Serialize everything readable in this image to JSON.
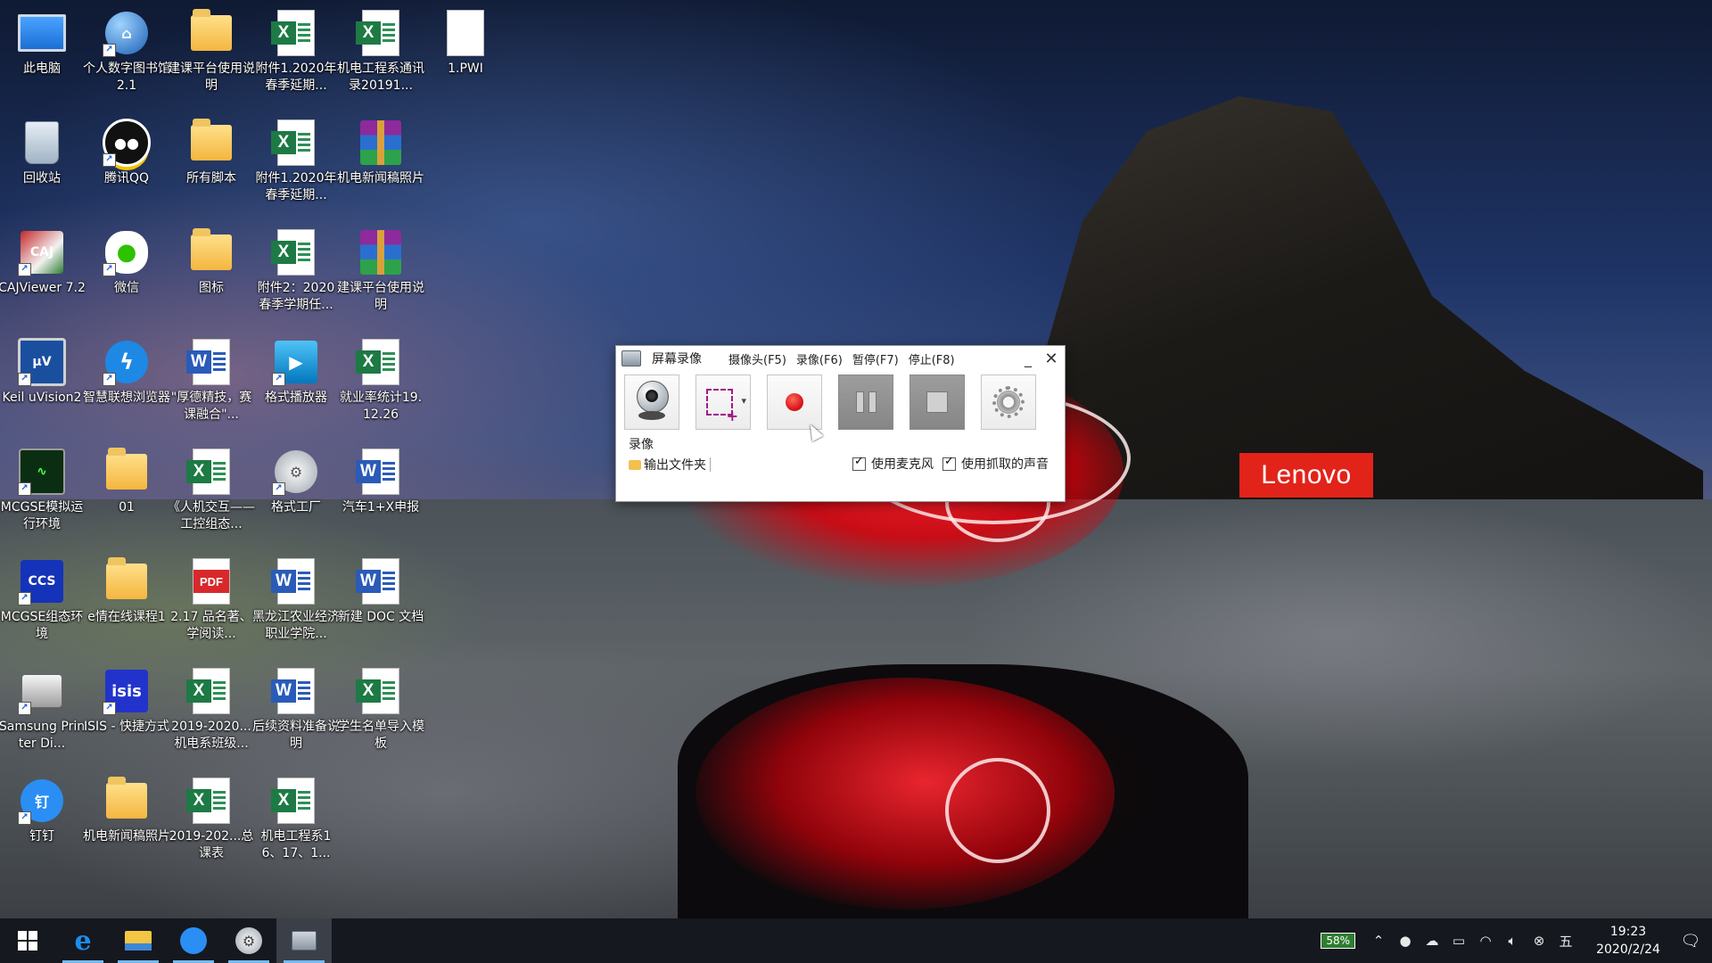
{
  "wallpaper": {
    "brand_text": "Lenovo",
    "brand_color": "#e2231a"
  },
  "desktop": {
    "icons": [
      {
        "label": "此电脑",
        "icon": "computer-icon"
      },
      {
        "label": "个人数字图书馆2.1",
        "icon": "globe-app-icon"
      },
      {
        "label": "建课平台使用说明",
        "icon": "folder-icon"
      },
      {
        "label": "附件1.2020年春季延期...",
        "icon": "excel-file-icon"
      },
      {
        "label": "机电工程系通讯录20191...",
        "icon": "excel-file-icon"
      },
      {
        "label": "1.PWI",
        "icon": "blank-file-icon"
      },
      {
        "label": "回收站",
        "icon": "recycle-bin-icon"
      },
      {
        "label": "腾讯QQ",
        "icon": "qq-icon"
      },
      {
        "label": "所有脚本",
        "icon": "folder-icon"
      },
      {
        "label": "附件1.2020年春季延期...",
        "icon": "excel-file-icon"
      },
      {
        "label": "机电新闻稿照片",
        "icon": "rar-archive-icon"
      },
      {
        "label": "CAJViewer 7.2",
        "icon": "cajviewer-icon"
      },
      {
        "label": "微信",
        "icon": "wechat-icon"
      },
      {
        "label": "图标",
        "icon": "folder-icon"
      },
      {
        "label": "附件2：2020春季学期任...",
        "icon": "excel-file-icon"
      },
      {
        "label": "建课平台使用说明",
        "icon": "rar-archive-icon"
      },
      {
        "label": "Keil uVision2",
        "icon": "keil-icon"
      },
      {
        "label": "智慧联想浏览器",
        "icon": "lenovo-browser-icon"
      },
      {
        "label": "\"厚德精技，赛课融合\"...",
        "icon": "word-file-icon"
      },
      {
        "label": "格式播放器",
        "icon": "video-player-icon"
      },
      {
        "label": "就业率统计19.12.26",
        "icon": "excel-file-icon"
      },
      {
        "label": "MCGSE模拟运行环境",
        "icon": "mcgs-sim-icon"
      },
      {
        "label": "01",
        "icon": "folder-icon"
      },
      {
        "label": "《人机交互——工控组态...",
        "icon": "excel-file-icon"
      },
      {
        "label": "格式工厂",
        "icon": "format-factory-icon"
      },
      {
        "label": "汽车1+X申报",
        "icon": "word-file-icon"
      },
      {
        "label": "MCGSE组态环境",
        "icon": "mcgs-config-icon"
      },
      {
        "label": "e情在线课程1",
        "icon": "folder-icon"
      },
      {
        "label": "2.17 品名著、学阅读...",
        "icon": "pdf-file-icon"
      },
      {
        "label": "黑龙江农业经济职业学院...",
        "icon": "word-file-icon"
      },
      {
        "label": "新建 DOC 文档",
        "icon": "word-file-icon"
      },
      {
        "label": "Samsung Printer Di...",
        "icon": "printer-icon"
      },
      {
        "label": "ISIS - 快捷方式",
        "icon": "isis-icon"
      },
      {
        "label": "2019-2020...机电系班级...",
        "icon": "excel-file-icon"
      },
      {
        "label": "后续资料准备说明",
        "icon": "word-file-icon"
      },
      {
        "label": "学生名单导入模板",
        "icon": "excel-file-icon"
      },
      {
        "label": "钉钉",
        "icon": "dingtalk-icon"
      },
      {
        "label": "机电新闻稿照片",
        "icon": "folder-icon"
      },
      {
        "label": "2019-202...总课表",
        "icon": "excel-file-icon"
      },
      {
        "label": "机电工程系16、17、1...",
        "icon": "excel-file-icon"
      }
    ]
  },
  "recorder": {
    "title": "屏幕录像",
    "menu": [
      "摄像头(F5)",
      "录像(F6)",
      "暂停(F7)",
      "停止(F8)"
    ],
    "buttons": [
      {
        "name": "webcam",
        "icon": "webcam-icon",
        "enabled": true
      },
      {
        "name": "region",
        "icon": "region-select-icon",
        "enabled": true
      },
      {
        "name": "record",
        "icon": "record-icon",
        "enabled": true
      },
      {
        "name": "pause",
        "icon": "pause-icon",
        "enabled": false
      },
      {
        "name": "stop",
        "icon": "stop-icon",
        "enabled": false
      },
      {
        "name": "settings",
        "icon": "gear-icon",
        "enabled": true
      }
    ],
    "status": "录像",
    "output_folder": "输出文件夹",
    "use_mic_label": "使用麦克风",
    "use_mic": true,
    "capture_audio_label": "使用抓取的声音",
    "capture_audio": true
  },
  "taskbar": {
    "apps": [
      {
        "name": "start",
        "icon": "windows-start-icon"
      },
      {
        "name": "edge",
        "icon": "edge-icon"
      },
      {
        "name": "file-explorer",
        "icon": "folder-icon"
      },
      {
        "name": "dingtalk",
        "icon": "dingtalk-icon"
      },
      {
        "name": "format-factory",
        "icon": "format-factory-icon"
      },
      {
        "name": "screen-recorder",
        "icon": "recorder-icon",
        "active": true
      }
    ],
    "battery": "58%",
    "ime": "五",
    "time": "19:23",
    "date": "2020/2/24"
  }
}
